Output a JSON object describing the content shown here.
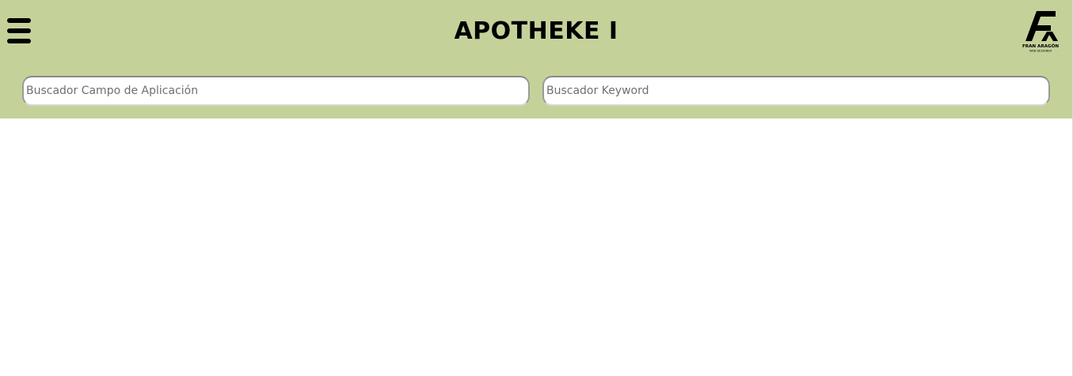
{
  "header": {
    "title": "APOTHEKE I",
    "background_color": "#c4d29a",
    "menu_icon": "hamburger-menu-icon",
    "logo": {
      "monogram": "FA",
      "name": "FRAN ARAGÓN",
      "tagline": "WEB DESIGNER"
    }
  },
  "search": {
    "campo_placeholder": "Buscador Campo de Aplicación",
    "campo_value": "",
    "keyword_placeholder": "Buscador Keyword",
    "keyword_value": ""
  }
}
